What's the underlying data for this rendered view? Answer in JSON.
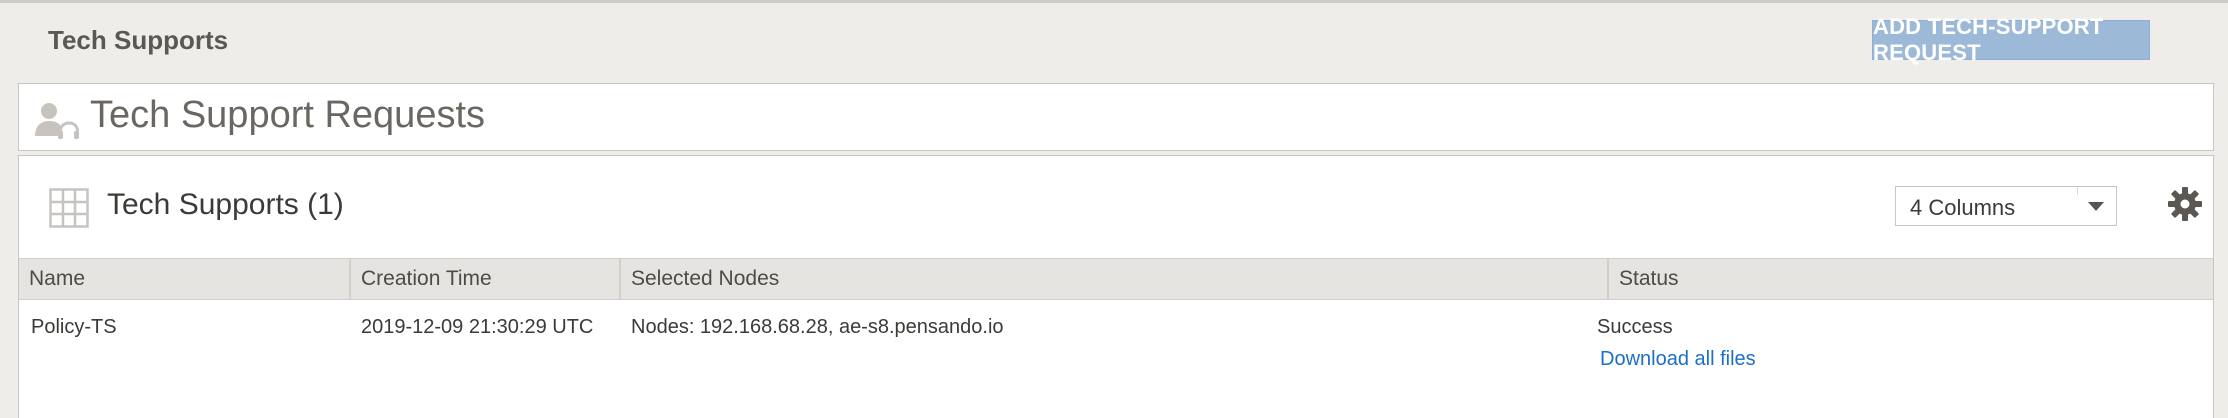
{
  "header": {
    "title": "Tech Supports",
    "add_button_label": "ADD TECH-SUPPORT REQUEST"
  },
  "requests_panel": {
    "title": "Tech Support Requests",
    "icon": "user-headset-icon"
  },
  "table_panel": {
    "title": "Tech Supports (1)",
    "icon": "grid-icon",
    "columns_select": {
      "selected": "4 Columns"
    },
    "settings_icon": "gear-icon"
  },
  "table": {
    "columns": [
      "Name",
      "Creation Time",
      "Selected Nodes",
      "Status"
    ],
    "rows": [
      {
        "name": "Policy-TS",
        "creation_time": "2019-12-09 21:30:29 UTC",
        "selected_nodes": "Nodes: 192.168.68.28, ae-s8.pensando.io",
        "status": "Success",
        "status_link": "Download all files"
      }
    ]
  },
  "colors": {
    "background": "#efedea",
    "accent_button": "#9db9d8",
    "link": "#1c6fc9",
    "header_row": "#e6e4e0"
  }
}
